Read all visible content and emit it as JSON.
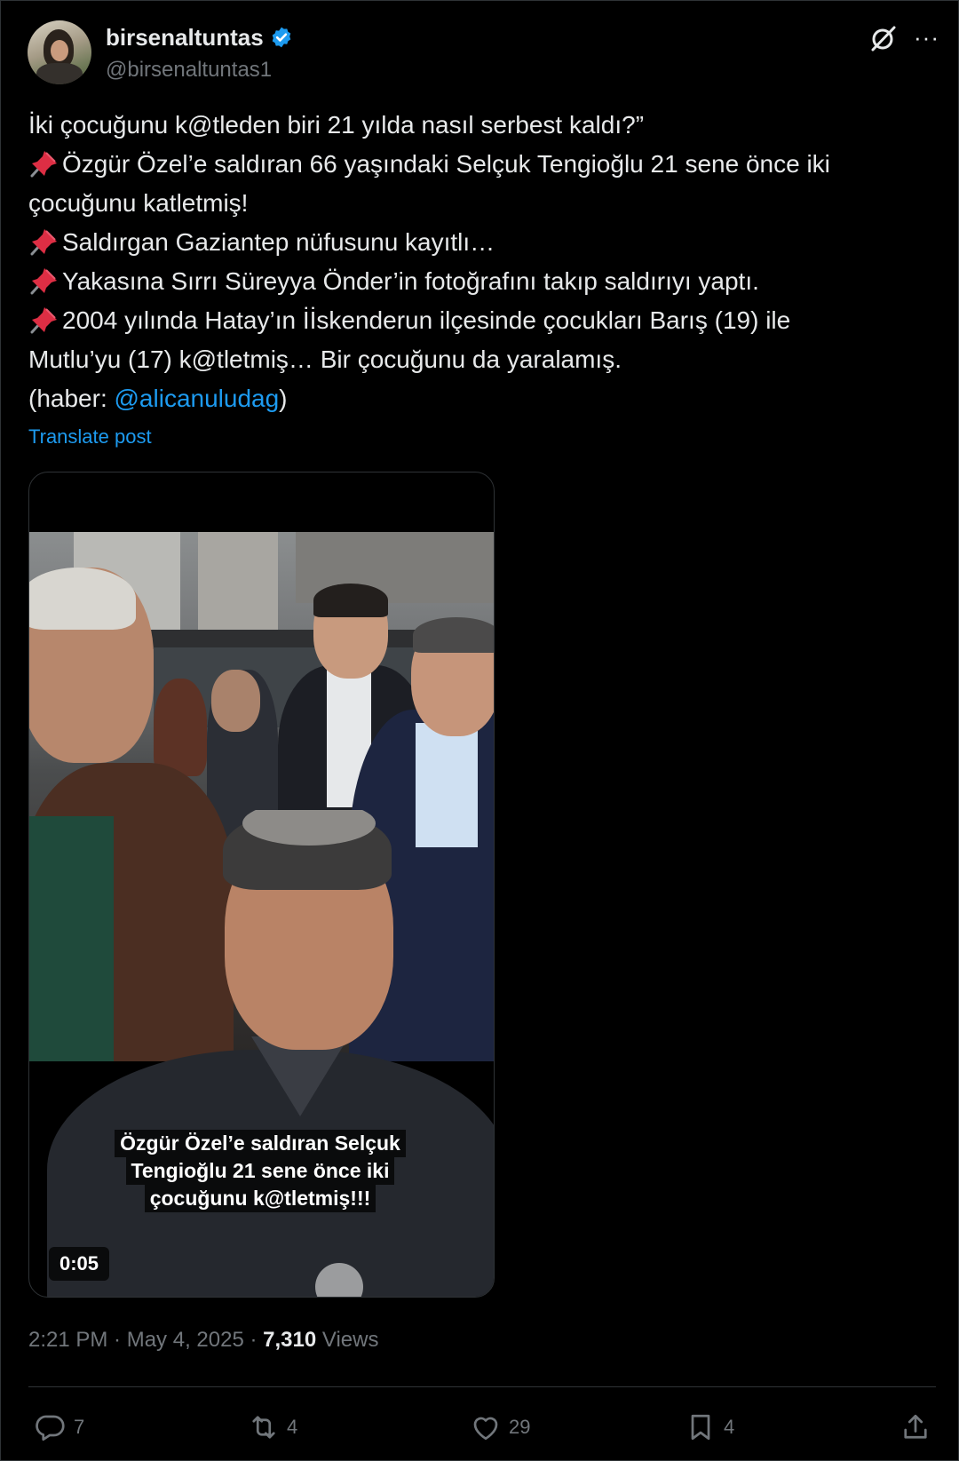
{
  "author": {
    "display_name": "birsenaltuntas",
    "handle": "@birsenaltuntas1",
    "verified": true,
    "avatar": "avatar-photo"
  },
  "header_icons": [
    "grok-icon",
    "more-icon"
  ],
  "header": {
    "more_label": "···"
  },
  "post": {
    "line1": "İki çocuğunu k@tleden biri 21 yılda nasıl serbest kaldı?”",
    "line2": "Özgür Özel’e saldıran 66 yaşındaki Selçuk Tengioğlu 21 sene önce iki",
    "line3": "çocuğunu katletmiş!",
    "line4": "Saldırgan Gaziantep nüfusunu kayıtlı…",
    "line5": "Yakasına Sırrı Süreyya Önder’in fotoğrafını takıp saldırıyı yaptı.",
    "line6": "2004 yılında Hatay’ın İİskenderun ilçesinde çocukları Barış (19) ile",
    "line7": "Mutlu’yu (17) k@tletmiş… Bir çocuğunu da yaralamış.",
    "line8_prefix": "(haber: ",
    "line8_mention": "@alicanuludag",
    "line8_suffix": ")",
    "pin_emoji": "pushpin-icon"
  },
  "translate_label": "Translate post",
  "media": {
    "caption_line1": "Özgür Özel’e saldıran Selçuk",
    "caption_line2": "Tengioğlu 21 sene önce iki",
    "caption_line3": "çocuğunu k@tletmiş!!!",
    "duration": "0:05"
  },
  "meta": {
    "time": "2:21 PM",
    "separator": " · ",
    "date": "May 4, 2025",
    "views_count": "7,310",
    "views_label": " Views"
  },
  "actions": {
    "replies": "7",
    "reposts": "4",
    "likes": "29",
    "bookmarks": "4"
  },
  "colors": {
    "background": "#000000",
    "text": "#e7e9ea",
    "muted": "#71767b",
    "accent": "#1d9bf0",
    "divider": "#2f3336"
  }
}
